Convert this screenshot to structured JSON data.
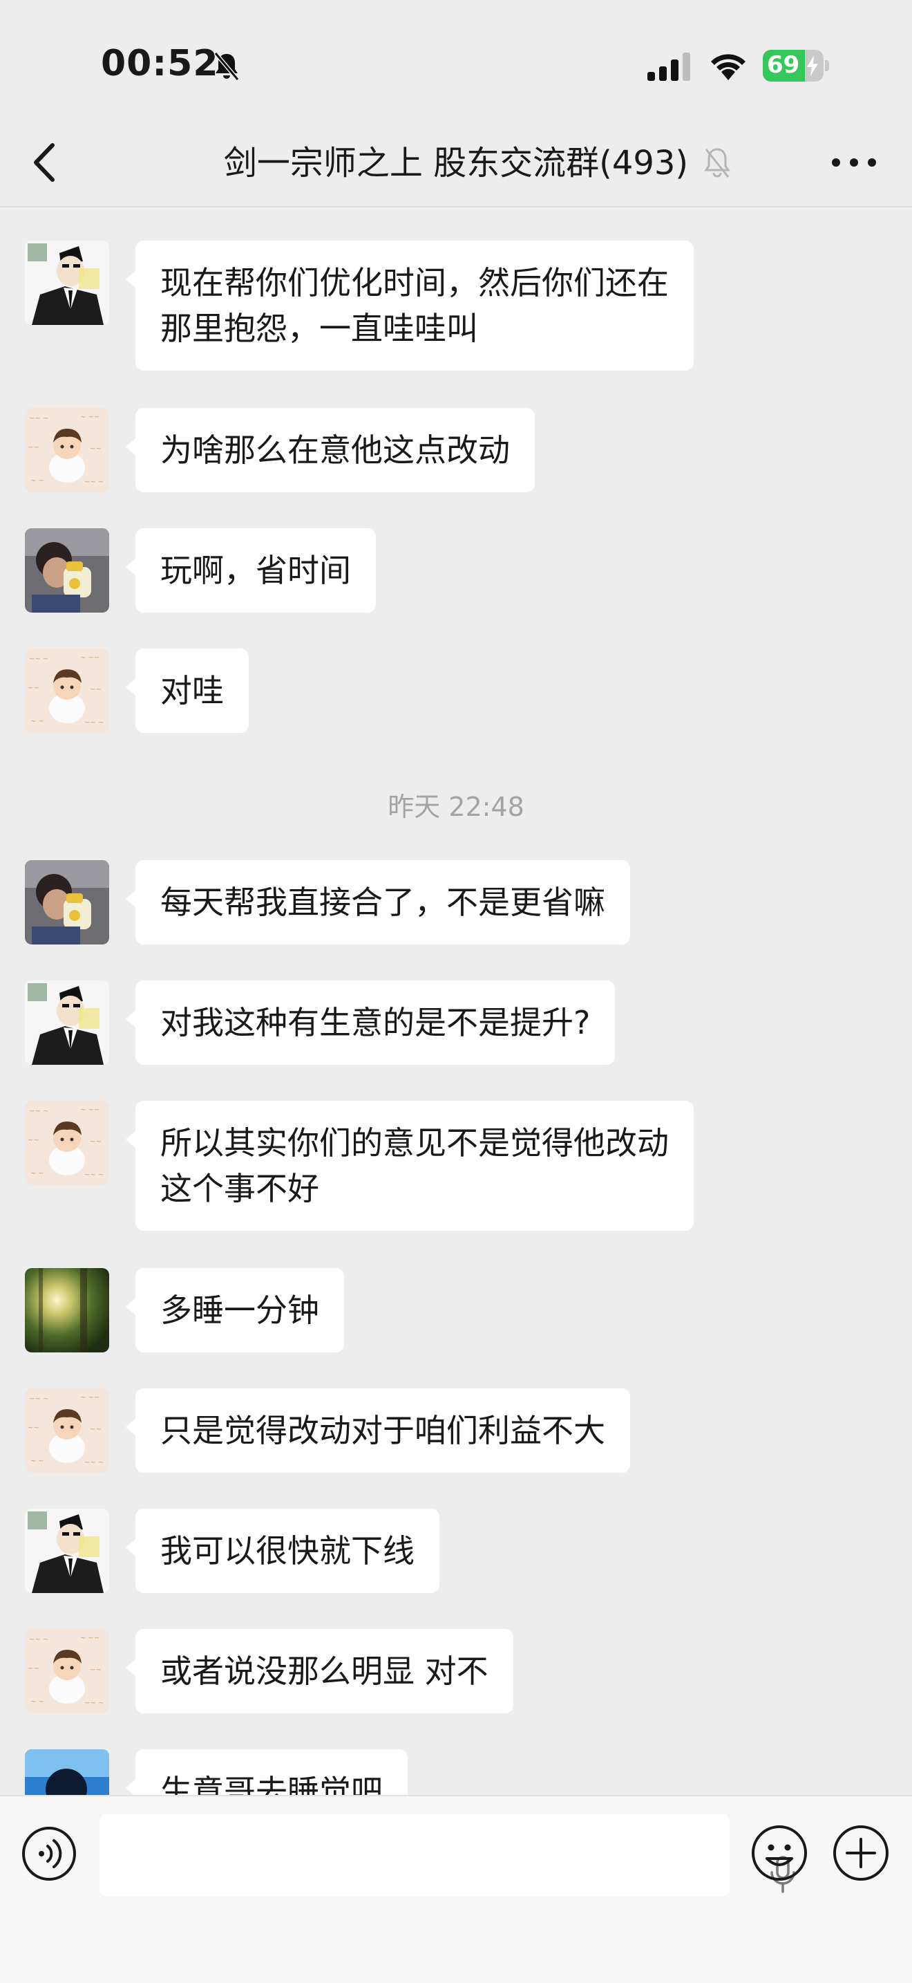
{
  "status_bar": {
    "time": "00:52",
    "battery_level": "69",
    "battery_fraction": 0.69,
    "battery_color": "#34c759",
    "icons": [
      "bell-slash-icon",
      "cellular-signal-icon",
      "wifi-icon",
      "battery-charging-icon"
    ]
  },
  "nav": {
    "title": "剑一宗师之上 股东交流群(493)",
    "icons": [
      "back-chevron-icon",
      "mute-bell-icon",
      "more-dots-icon"
    ]
  },
  "messages": [
    {
      "avatar": "crayon-shin-chan-suit-avatar",
      "text": "现在帮你们优化时间，然后你们还在\n那里抱怨，一直哇哇叫"
    },
    {
      "avatar": "meditating-boy-avatar",
      "text": "为啥那么在意他这点改动"
    },
    {
      "avatar": "child-bottle-photo-avatar",
      "text": "玩啊，省时间"
    },
    {
      "avatar": "meditating-boy-avatar",
      "text": "对哇"
    },
    {
      "avatar": "child-bottle-photo-avatar",
      "text": "每天帮我直接合了，不是更省嘛"
    },
    {
      "avatar": "crayon-shin-chan-suit-avatar",
      "text": "对我这种有生意的是不是提升?"
    },
    {
      "avatar": "meditating-boy-avatar",
      "text": "所以其实你们的意见不是觉得他改动\n这个事不好"
    },
    {
      "avatar": "forest-sunlight-avatar",
      "text": "多睡一分钟"
    },
    {
      "avatar": "meditating-boy-avatar",
      "text": "只是觉得改动对于咱们利益不大"
    },
    {
      "avatar": "crayon-shin-chan-suit-avatar",
      "text": "我可以很快就下线"
    },
    {
      "avatar": "meditating-boy-avatar",
      "text": "或者说没那么明显 对不"
    },
    {
      "avatar": "ocean-anime-avatar",
      "text": "生意哥去睡觉吧"
    }
  ],
  "timestamp": "昨天 22:48",
  "input_bar": {
    "placeholder": "",
    "icons": [
      "voice-mode-icon",
      "microphone-icon",
      "emoji-icon",
      "plus-icon"
    ]
  }
}
